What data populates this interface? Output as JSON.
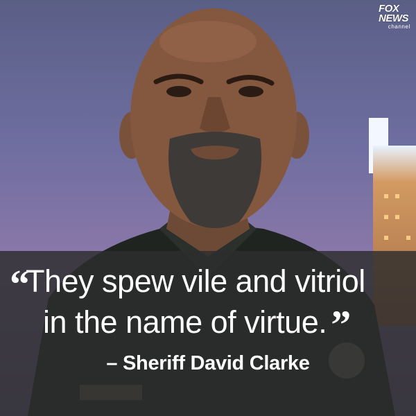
{
  "quote": {
    "open_mark": "“",
    "line1": "They spew vile and vitriol",
    "line2": "in the name of virtue.",
    "close_mark": "”"
  },
  "attribution": "– Sheriff David Clarke",
  "logo": {
    "line1": "FOX",
    "line2": "NEWS",
    "line3": "channel"
  },
  "colors": {
    "overlay": "#2d2d2d",
    "text": "#ffffff",
    "background_sky": "#6f6ea0"
  }
}
